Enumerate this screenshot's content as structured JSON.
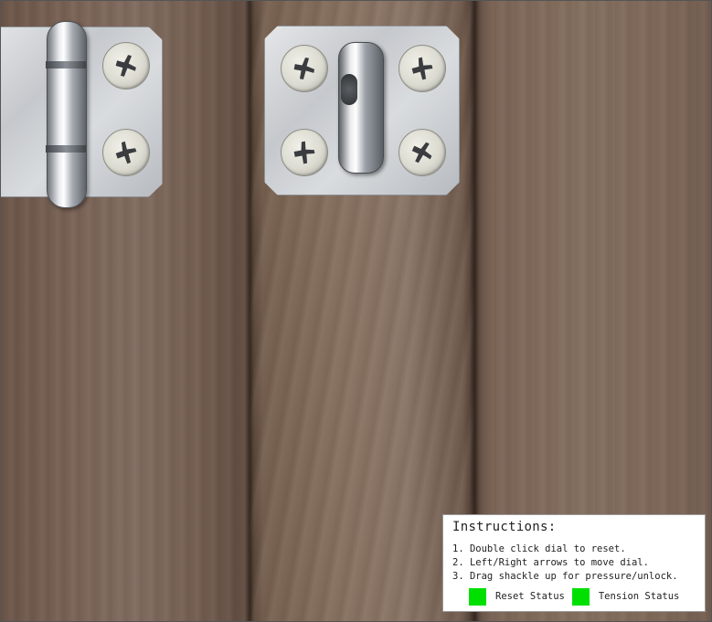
{
  "instructions": {
    "title": "Instructions:",
    "steps": [
      "1. Double click dial to reset.",
      "2. Left/Right arrows to move dial.",
      "3. Drag shackle up for pressure/unlock."
    ],
    "status_indicators": [
      {
        "label": "Reset Status",
        "color": "#00e000"
      },
      {
        "label": "Tension Status",
        "color": "#00e000"
      }
    ]
  },
  "icons": [
    "hinge-icon",
    "hasp-staple-icon",
    "phillips-screw-icon"
  ],
  "colors": {
    "wood": "#7a6356",
    "metal": "#c5c8cc",
    "status_ok": "#00e000",
    "panel_bg": "#ffffff"
  }
}
